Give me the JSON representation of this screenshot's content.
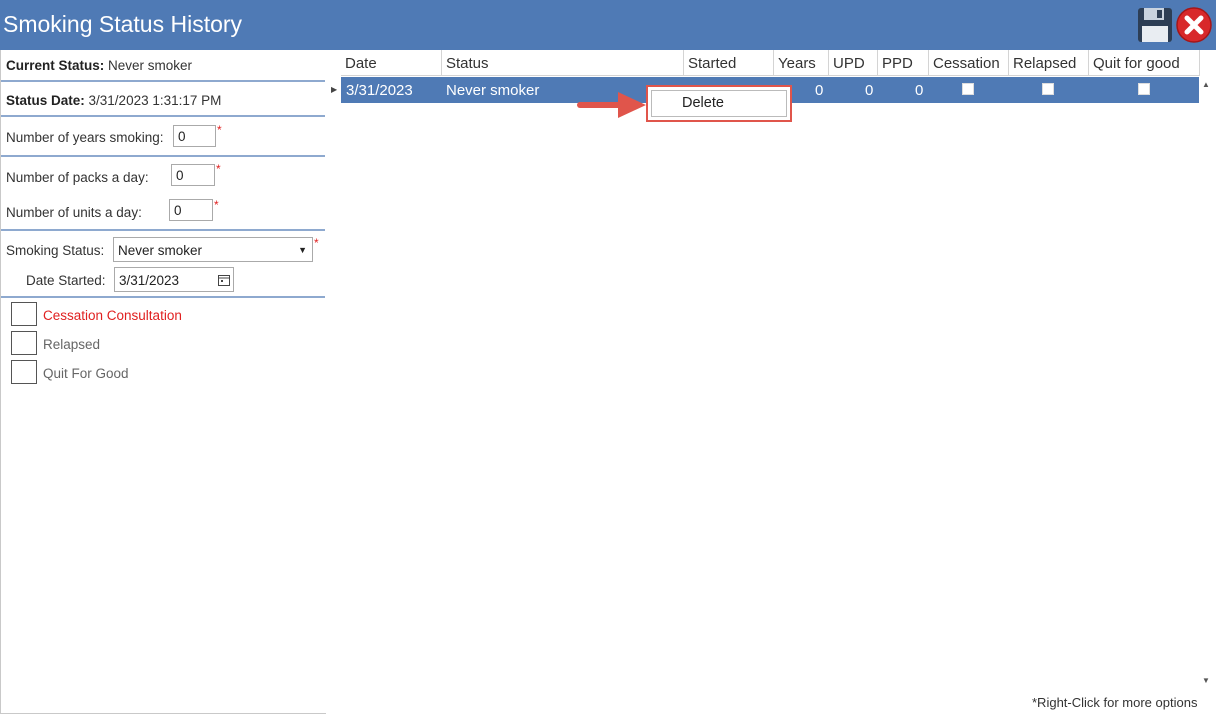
{
  "window": {
    "title": "Smoking Status History",
    "save_icon": "floppy-disk-icon",
    "close_icon": "close-x-icon"
  },
  "left_panel": {
    "current_status_label": "Current Status:",
    "current_status_value": "Never smoker",
    "status_date_label": "Status Date:",
    "status_date_value": "3/31/2023 1:31:17 PM",
    "years_smoking_label": "Number of years smoking:",
    "years_smoking_value": "0",
    "packs_a_day_label": "Number of packs a day:",
    "packs_a_day_value": "0",
    "units_a_day_label": "Number of units a day:",
    "units_a_day_value": "0",
    "required_mark": "*",
    "smoking_status_label": "Smoking Status:",
    "smoking_status_value": "Never smoker",
    "date_started_label": "Date Started:",
    "date_started_value": "3/31/2023",
    "checkboxes": [
      {
        "label": "Cessation Consultation",
        "checked": false,
        "color": "#e02020"
      },
      {
        "label": "Relapsed",
        "checked": false,
        "color": "#666666"
      },
      {
        "label": "Quit For Good",
        "checked": false,
        "color": "#666666"
      }
    ]
  },
  "grid": {
    "columns": [
      "Date",
      "Status",
      "Started",
      "Years",
      "UPD",
      "PPD",
      "Cessation",
      "Relapsed",
      "Quit for good"
    ],
    "rows": [
      {
        "date": "3/31/2023",
        "status": "Never smoker",
        "started": "",
        "years": "0",
        "upd": "0",
        "ppd": "0",
        "cessation": false,
        "relapsed": false,
        "quit_for_good": false
      }
    ],
    "footer_hint": "*Right-Click for more options"
  },
  "context_menu": {
    "items": [
      "Delete"
    ]
  },
  "colors": {
    "title_bar": "#4f7ab5",
    "selected_row": "#4f7ab5",
    "highlight_arrow": "#e0554b",
    "required": "#e02020"
  }
}
